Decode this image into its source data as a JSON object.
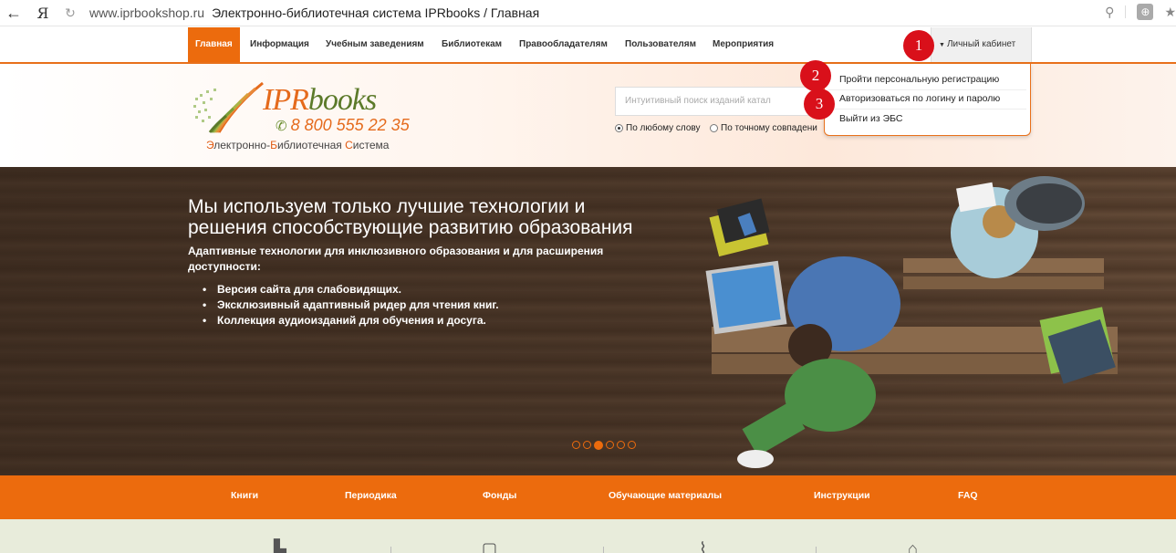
{
  "browser": {
    "back": "←",
    "ya": "Я",
    "reload": "↻",
    "url": "www.iprbookshop.ru",
    "title": "Электронно-библиотечная система IPRbooks / Главная"
  },
  "topnav": {
    "items": [
      "Главная",
      "Информация",
      "Учебным заведениям",
      "Библиотекам",
      "Правообладателям",
      "Пользователям",
      "Мероприятия"
    ],
    "cabinet": "Личный кабинет"
  },
  "logo": {
    "name_a": "IPR",
    "name_b": "books",
    "phone": "8 800 555 22 35",
    "sub": [
      "Э",
      "лектронно-",
      "Б",
      "иблиотечная ",
      "С",
      "истема"
    ]
  },
  "search": {
    "placeholder": "Интуитивный поиск изданий катал",
    "opt_any": "По любому слову",
    "opt_exact": "По точному совпадени"
  },
  "dropdown": {
    "items": [
      "Пройти персональную регистрацию",
      "Авторизоваться по логину и паролю",
      "Выйти из ЭБС"
    ]
  },
  "markers": [
    "1",
    "2",
    "3"
  ],
  "hero": {
    "title_1": "Мы используем только лучшие технологии и",
    "title_2": "решения способствующие развитию образования",
    "sub_1": "Адаптивные технологии для инклюзивного образования и для расширения",
    "sub_2": "доступности:",
    "bullets": [
      "Версия сайта для слабовидящих.",
      "Эксклюзивный адаптивный ридер для чтения книг.",
      "Коллекция аудиоизданий для обучения и досуга."
    ],
    "slides": 6,
    "active_slide": 3
  },
  "bottom_menu": [
    "Книги",
    "Периодика",
    "Фонды",
    "Обучающие материалы",
    "Инструкции",
    "FAQ"
  ],
  "colors": {
    "accent": "#ec6b0d",
    "marker": "#d9101a",
    "logo_green": "#5c7a2a"
  }
}
